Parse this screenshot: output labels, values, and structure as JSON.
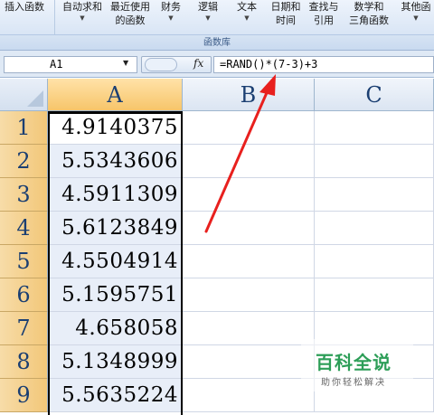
{
  "ribbon": {
    "buttons": [
      {
        "l1": "插入函数",
        "l2": "",
        "arrow": ""
      },
      {
        "l1": "自动求和",
        "l2": "",
        "arrow": "▼"
      },
      {
        "l1": "最近使用",
        "l2": "的函数",
        "arrow": "▼"
      },
      {
        "l1": "财务",
        "l2": "",
        "arrow": "▼"
      },
      {
        "l1": "逻辑",
        "l2": "",
        "arrow": "▼"
      },
      {
        "l1": "文本",
        "l2": "",
        "arrow": "▼"
      },
      {
        "l1": "日期和",
        "l2": "时间",
        "arrow": "▼"
      },
      {
        "l1": "查找与",
        "l2": "引用",
        "arrow": "▼"
      },
      {
        "l1": "数学和",
        "l2": "三角函数",
        "arrow": "▼"
      },
      {
        "l1": "其他函",
        "l2": "",
        "arrow": "▼"
      }
    ],
    "group_label": "函数库"
  },
  "formula_bar": {
    "name_box": "A1",
    "fx": "fx",
    "formula": "=RAND()*(7-3)+3"
  },
  "columns": [
    "A",
    "B",
    "C"
  ],
  "rows": [
    {
      "num": "1",
      "a": "4.9140375"
    },
    {
      "num": "2",
      "a": "5.5343606"
    },
    {
      "num": "3",
      "a": "4.5911309"
    },
    {
      "num": "4",
      "a": "5.6123849"
    },
    {
      "num": "5",
      "a": "4.5504914"
    },
    {
      "num": "6",
      "a": "5.1595751"
    },
    {
      "num": "7",
      "a": "4.658058"
    },
    {
      "num": "8",
      "a": "5.1348999"
    },
    {
      "num": "9",
      "a": "5.5635224"
    }
  ],
  "watermark": {
    "main": "百科全说",
    "sub": "助你轻松解决"
  },
  "colors": {
    "arrow": "#e8201e",
    "row_header": "#f2c779",
    "selected_column": "#f7c56a",
    "selection_fill": "#e8eef8"
  }
}
